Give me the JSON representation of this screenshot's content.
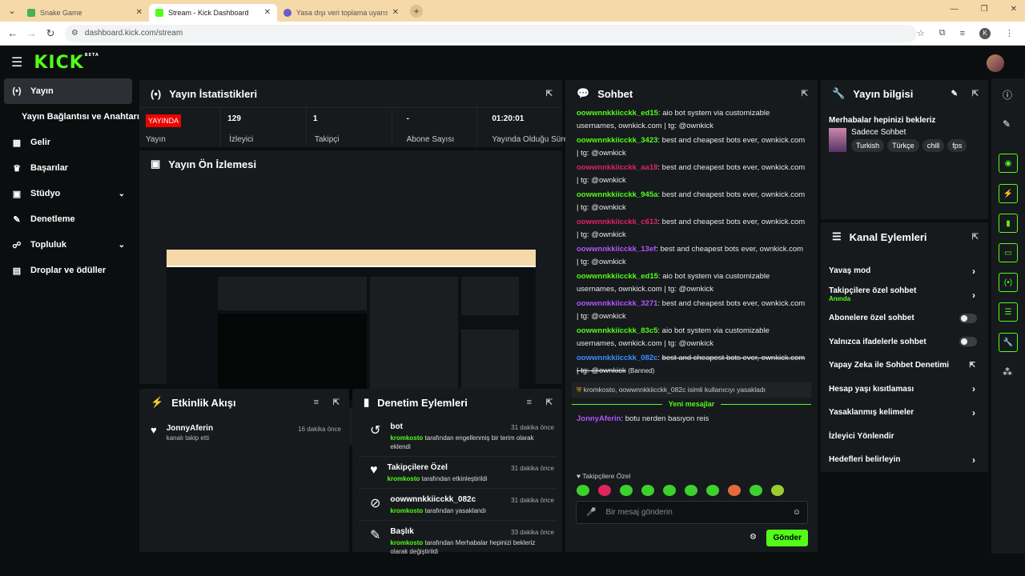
{
  "browser": {
    "tabs": [
      {
        "title": "Snake Game",
        "color": "#4caf50"
      },
      {
        "title": "Stream - Kick Dashboard",
        "color": "#53fc18"
      },
      {
        "title": "Yasa dışı veri toplama uyarısı - L",
        "color": "#6a5acd"
      }
    ],
    "url": "dashboard.kick.com/stream",
    "profile_initial": "K"
  },
  "brand": {
    "logo": "KICK",
    "beta": "BETA"
  },
  "sidebar": {
    "items": [
      {
        "label": "Yayın",
        "icon": "(•)"
      },
      {
        "label": "Yayın Bağlantısı ve Anahtarı",
        "icon": ""
      },
      {
        "label": "Gelir",
        "icon": "▦"
      },
      {
        "label": "Başarılar",
        "icon": "🏆"
      },
      {
        "label": "Stüdyo",
        "icon": "▣"
      },
      {
        "label": "Denetleme",
        "icon": "🔧"
      },
      {
        "label": "Topluluk",
        "icon": "👥"
      },
      {
        "label": "Droplar ve ödüller",
        "icon": "▤"
      }
    ]
  },
  "stats": {
    "title": "Yayın İstatistikleri",
    "live": "YAYINDA",
    "live_label": "Yayın",
    "viewers": "129",
    "viewers_label": "İzleyici",
    "followers": "1",
    "followers_label": "Takipçi",
    "subs": "-",
    "subs_label": "Abone Sayısı",
    "duration": "01:20:01",
    "duration_label": "Yayında Olduğu Süre"
  },
  "preview": {
    "title": "Yayın Ön İzlemesi"
  },
  "activity": {
    "title": "Etkinlik Akışı",
    "items": [
      {
        "user": "JonnyAferin",
        "text": "kanalı takip etti",
        "time": "16 dakika önce"
      }
    ]
  },
  "modlog": {
    "title": "Denetim Eylemleri",
    "items": [
      {
        "title": "bot",
        "user": "kromkosto",
        "text": "tarafından engellenmiş bir terim olarak eklendi",
        "time": "31 dakika önce"
      },
      {
        "title": "Takipçilere Özel",
        "user": "kromkosto",
        "text": "tarafından etkinleştirildi",
        "time": "31 dakika önce"
      },
      {
        "title": "oowwnnkkiicckk_082c",
        "user": "kromkosto",
        "text": "tarafından yasaklandı",
        "time": "31 dakika önce"
      },
      {
        "title": "Başlık",
        "user": "kromkosto",
        "text": "tarafından Merhabalar hepinizi bekleriz olarak değiştirildi",
        "time": "33 dakika önce"
      }
    ]
  },
  "chat": {
    "title": "Sohbet",
    "messages": [
      {
        "user": "oowwnnkkiicckk_ed15",
        "color": "#53fc18",
        "text": "aio bot system via customizable usernames, ownkick.com | tg: @ownkick",
        "strike": false
      },
      {
        "user": "oowwnnkkiicckk_3423",
        "color": "#53fc18",
        "text": "best and cheapest bots ever, ownkick.com | tg: @ownkick",
        "strike": false
      },
      {
        "user": "oowwnnkkiicckk_aa18",
        "color": "#e0245e",
        "text": "best and cheapest bots ever, ownkick.com | tg: @ownkick",
        "strike": false
      },
      {
        "user": "oowwnnkkiicckk_945a",
        "color": "#53fc18",
        "text": "best and cheapest bots ever, ownkick.com | tg: @ownkick",
        "strike": false
      },
      {
        "user": "oowwnnkkiicckk_c613",
        "color": "#e0245e",
        "text": "best and cheapest bots ever, ownkick.com | tg: @ownkick",
        "strike": false
      },
      {
        "user": "oowwnnkkiicckk_13ef",
        "color": "#b455ff",
        "text": "best and cheapest bots ever, ownkick.com | tg: @ownkick",
        "strike": false
      },
      {
        "user": "oowwnnkkiicckk_ed15",
        "color": "#53fc18",
        "text": "aio bot system via customizable usernames, ownkick.com | tg: @ownkick",
        "strike": false
      },
      {
        "user": "oowwnnkkiicckk_3271",
        "color": "#b455ff",
        "text": "best and cheapest bots ever, ownkick.com | tg: @ownkick",
        "strike": false
      },
      {
        "user": "oowwnnkkiicckk_83c5",
        "color": "#53fc18",
        "text": "aio bot system via customizable usernames, ownkick.com | tg: @ownkick",
        "strike": false
      },
      {
        "user": "oowwnnkkiicckk_082c",
        "color": "#3a8fff",
        "text": "best and cheapest bots ever, ownkick.com | tg: @ownkick",
        "strike": true,
        "suffix": "(Banned)"
      }
    ],
    "system": "kromkosto, oowwnnkkiicckk_082c isimli kullanıcıyı yasakladı",
    "new_messages": "Yeni mesajlar",
    "last": {
      "user": "JonnyAferin",
      "text": "botu nerden basıyon reis"
    },
    "mode": "♥ Takipçilere Özel",
    "placeholder": "Bir mesaj gönderin",
    "send": "Gönder"
  },
  "info": {
    "title": "Yayın bilgisi",
    "stream_title": "Merhabalar hepinizi bekleriz",
    "category": "Sadece Sohbet",
    "tags": [
      "Turkish",
      "Türkçe",
      "chill",
      "fps"
    ]
  },
  "actions": {
    "title": "Kanal Eylemleri",
    "items": [
      {
        "label": "Yavaş mod",
        "type": "chev"
      },
      {
        "label": "Takipçilere özel sohbet",
        "sub": "Anında",
        "type": "chev"
      },
      {
        "label": "Abonelere özel sohbet",
        "type": "toggle"
      },
      {
        "label": "Yalnızca ifadelerle sohbet",
        "type": "toggle"
      },
      {
        "label": "Yapay Zeka ile Sohbet Denetimi",
        "type": "ext"
      },
      {
        "label": "Hesap yaşı kısıtlaması",
        "type": "chev"
      },
      {
        "label": "Yasaklanmış kelimeler",
        "type": "chev"
      },
      {
        "label": "İzleyici Yönlendir",
        "type": "none"
      },
      {
        "label": "Hedefleri belirleyin",
        "type": "chev"
      }
    ]
  },
  "colors": {
    "accent": "#53fc18",
    "panel": "#161a1d",
    "bg": "#0b0e0f",
    "live": "#eb0400"
  }
}
